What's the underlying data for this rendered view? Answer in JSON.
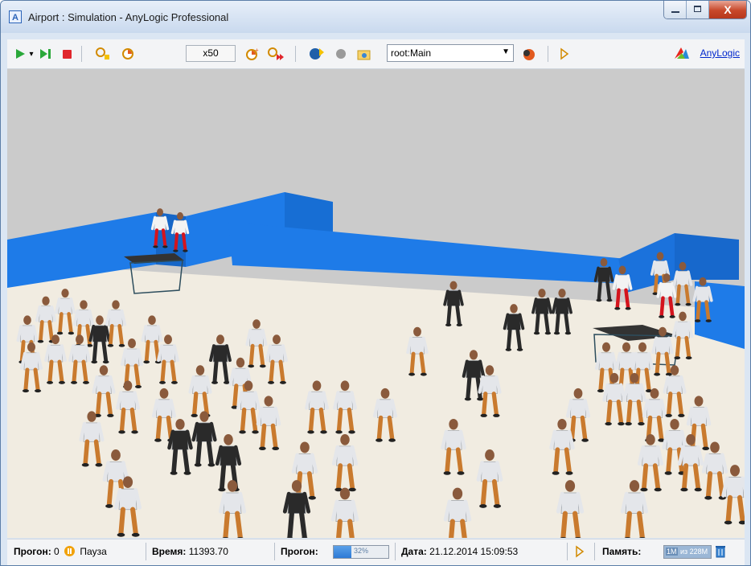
{
  "window": {
    "title": "Airport : Simulation - AnyLogic Professional",
    "app_icon": "anylogic-app-icon",
    "controls": {
      "minimize": "minimize-icon",
      "maximize": "maximize-icon",
      "close_glyph": "X"
    }
  },
  "toolbar": {
    "run": "play-icon",
    "run_menu": "▾",
    "step": "step-icon",
    "stop": "stop-icon",
    "speed": "x50",
    "root_combo": "root:Main",
    "link": "AnyLogic"
  },
  "statusbar": {
    "run_label": "Прогон:",
    "run_value": "0",
    "state": "Пауза",
    "time_label": "Время:",
    "time_value": "11393.70",
    "progress_label": "Прогон:",
    "progress_text": "32%",
    "progress_fraction": 0.32,
    "date_label": "Дата:",
    "date_value": "21.12.2014 15:09:53",
    "memory_label": "Память:",
    "memory_used": "1M",
    "memory_of": "из 228M"
  },
  "colors": {
    "wall": "#1e7be8",
    "floor": "#f1ece1",
    "background": "#cbcbcb",
    "shirt": "#e4e6ea",
    "pants": "#c97a2e",
    "suit": "#2a2a2a"
  }
}
